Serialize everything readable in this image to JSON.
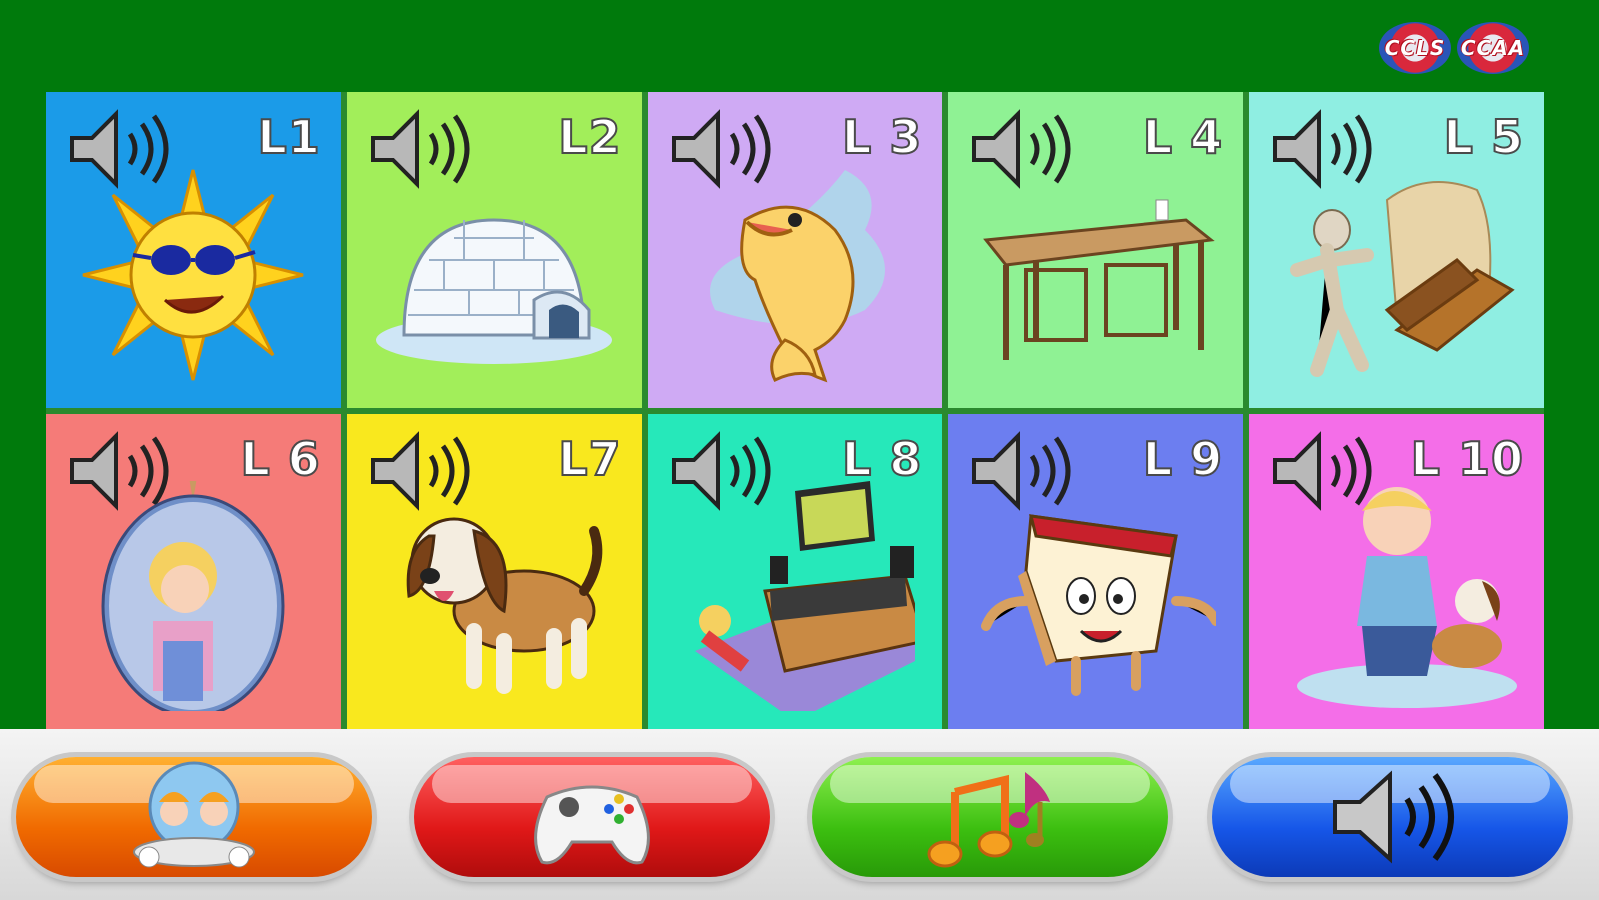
{
  "header": {
    "logos": [
      {
        "text": "CCLS",
        "icon": "ccls-badge-logo"
      },
      {
        "text": "CCAA",
        "icon": "ccaa-badge-logo"
      }
    ]
  },
  "lessons": [
    {
      "label": "L1",
      "picture": "sun",
      "color": "#1b9be8"
    },
    {
      "label": "L2",
      "picture": "igloo",
      "color": "#a2ee5a"
    },
    {
      "label": "L 3",
      "picture": "fish",
      "color": "#cfaaf4"
    },
    {
      "label": "L 4",
      "picture": "table-and-chairs",
      "color": "#8ff294"
    },
    {
      "label": "L 5",
      "picture": "mummy-and-coffin",
      "color": "#8feee2"
    },
    {
      "label": "L 6",
      "picture": "girl-in-mirror",
      "color": "#f57b78"
    },
    {
      "label": "L7",
      "picture": "puppy",
      "color": "#f9e81e"
    },
    {
      "label": "L 8",
      "picture": "living-room-tv",
      "color": "#26e8ba"
    },
    {
      "label": "L 9",
      "picture": "cheesecake",
      "color": "#6c7ef0"
    },
    {
      "label": "L 10",
      "picture": "boy-washing-dog",
      "color": "#f46ee8"
    }
  ],
  "bottom_bar": {
    "buttons": [
      {
        "name": "characters",
        "icon": "kids-globe-icon"
      },
      {
        "name": "games",
        "icon": "game-controller-icon"
      },
      {
        "name": "songs",
        "icon": "music-notes-icon"
      },
      {
        "name": "audio",
        "icon": "speaker-icon"
      }
    ]
  }
}
